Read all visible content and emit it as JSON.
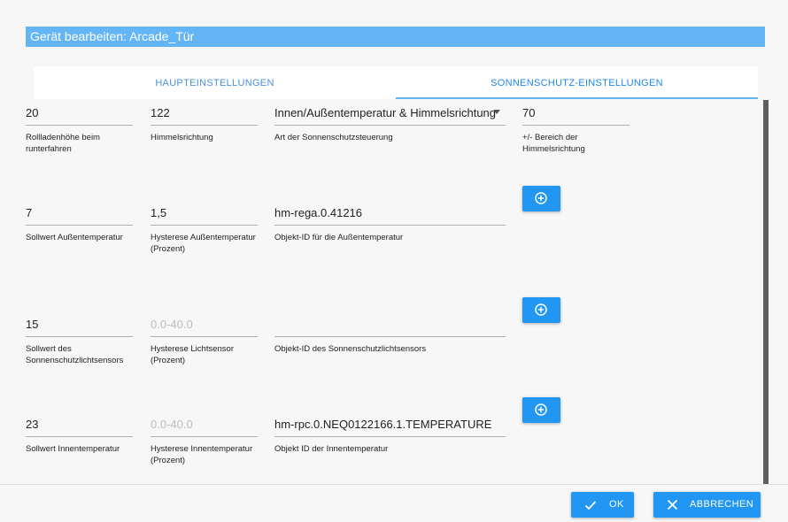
{
  "dialog": {
    "title": "Gerät bearbeiten: Arcade_Tür"
  },
  "tabs": [
    {
      "label": "HAUPTEINSTELLUNGEN"
    },
    {
      "label": "SONNENSCHUTZ-EINSTELLUNGEN"
    }
  ],
  "rows": [
    {
      "f1": {
        "value": "20",
        "label": "Rollladenhöhe beim runterfahren"
      },
      "f2": {
        "value": "122",
        "label": "Himmelsrichtung"
      },
      "f3": {
        "value": "Innen/Außentemperatur & Himmelsrichtung",
        "label": "Art der Sonnenschutzsteuerung"
      },
      "f4": {
        "value": "70",
        "label": "+/- Bereich der Himmelsrichtung"
      }
    },
    {
      "f1": {
        "value": "7",
        "label": "Sollwert Außentemperatur"
      },
      "f2": {
        "value": "1,5",
        "label": "Hysterese Außentemperatur (Prozent)"
      },
      "f3": {
        "value": "hm-rega.0.41216",
        "label": "Objekt-ID für die Außentemperatur"
      }
    },
    {
      "f1": {
        "value": "15",
        "label": "Sollwert des Sonnenschutzlichtsensors"
      },
      "f2": {
        "placeholder": "0.0-40.0",
        "label": "Hysterese Lichtsensor (Prozent)"
      },
      "f3": {
        "value": "",
        "label": "Objekt-ID des Sonnenschutzlichtsensors"
      }
    },
    {
      "f1": {
        "value": "23",
        "label": "Sollwert Innentemperatur"
      },
      "f2": {
        "placeholder": "0.0-40.0",
        "label": "Hysterese Innentemperatur (Prozent)"
      },
      "f3": {
        "value": "hm-rpc.0.NEQ0122166.1.TEMPERATURE",
        "label": "Objekt ID der Innentemperatur"
      }
    }
  ],
  "footer": {
    "ok_label": "OK",
    "cancel_label": "ABBRECHEN"
  },
  "colors": {
    "accent": "#2196f3",
    "titlebar": "#64b5f6"
  },
  "icons": {
    "add": "plus-circle-icon",
    "ok": "check-icon",
    "cancel": "close-icon",
    "dropdown": "arrow-drop-down-icon"
  }
}
